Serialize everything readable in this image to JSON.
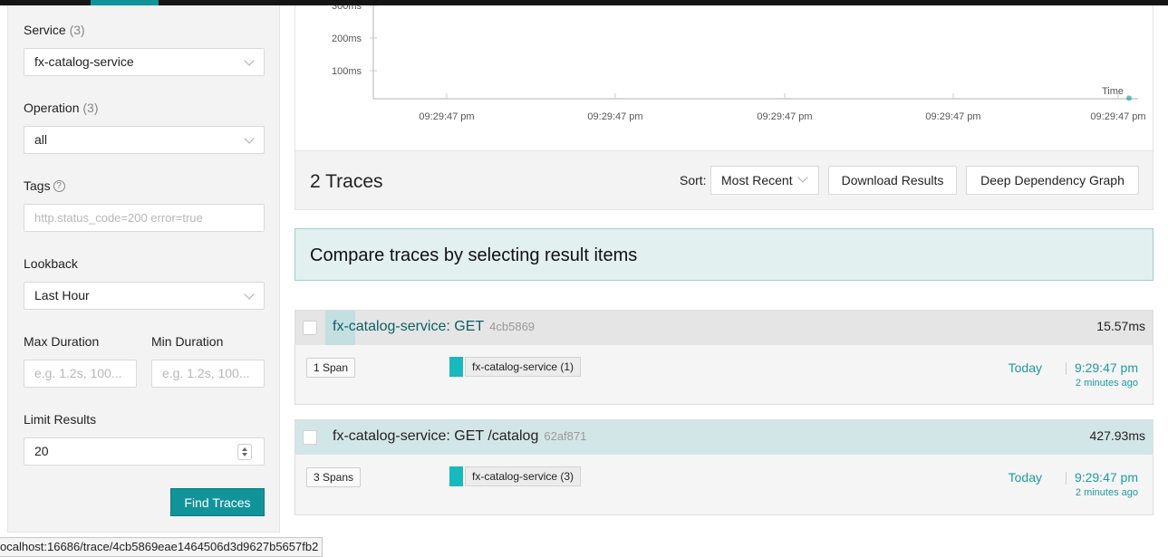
{
  "search": {
    "service_label": "Service",
    "service_count": "(3)",
    "service_value": "fx-catalog-service",
    "operation_label": "Operation",
    "operation_count": "(3)",
    "operation_value": "all",
    "tags_label": "Tags",
    "tags_placeholder": "http.status_code=200 error=true",
    "lookback_label": "Lookback",
    "lookback_value": "Last Hour",
    "max_duration_label": "Max Duration",
    "max_duration_placeholder": "e.g. 1.2s, 100...",
    "min_duration_label": "Min Duration",
    "min_duration_placeholder": "e.g. 1.2s, 100...",
    "limit_label": "Limit Results",
    "limit_value": "20",
    "find_button": "Find Traces"
  },
  "chart_data": {
    "type": "scatter",
    "y_ticks": [
      "300ms",
      "200ms",
      "100ms"
    ],
    "x_ticks": [
      "09:29:47 pm",
      "09:29:47 pm",
      "09:29:47 pm",
      "09:29:47 pm",
      "09:29:47 pm"
    ],
    "xlabel": "Time",
    "points": [
      {
        "x": "09:29:47 pm",
        "y": 15.57
      }
    ],
    "accent": "#11939a"
  },
  "results": {
    "count_label": "2 Traces",
    "sort_label": "Sort:",
    "sort_value": "Most Recent",
    "download_button": "Download Results",
    "ddg_button": "Deep Dependency Graph",
    "compare_banner": "Compare traces by selecting result items"
  },
  "traces": [
    {
      "name": "fx-catalog-service: GET",
      "id": "4cb5869",
      "duration": "15.57ms",
      "spans": "1 Span",
      "service": "fx-catalog-service (1)",
      "day": "Today",
      "time": "9:29:47 pm",
      "ago": "2 minutes ago"
    },
    {
      "name": "fx-catalog-service: GET /catalog",
      "id": "62af871",
      "duration": "427.93ms",
      "spans": "3 Spans",
      "service": "fx-catalog-service (3)",
      "day": "Today",
      "time": "9:29:47 pm",
      "ago": "2 minutes ago"
    }
  ],
  "status_bar": {
    "url": "ocalhost:16686/trace/4cb5869eae1464506d3d9627b5657fb2"
  },
  "colors": {
    "accent": "#11939a",
    "service_swatch": "#17b8be"
  }
}
